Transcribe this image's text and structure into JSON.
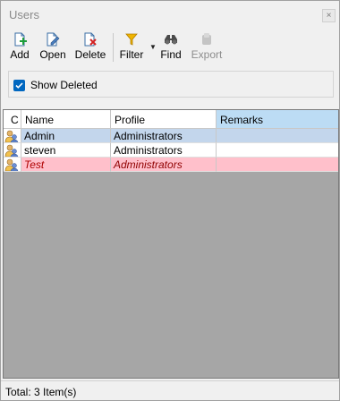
{
  "window": {
    "title": "Users",
    "close_glyph": "×"
  },
  "toolbar": {
    "add": {
      "label": "Add",
      "icon": "add-document-icon"
    },
    "open": {
      "label": "Open",
      "icon": "open-document-icon"
    },
    "delete": {
      "label": "Delete",
      "icon": "delete-document-icon"
    },
    "filter": {
      "label": "Filter",
      "icon": "funnel-icon"
    },
    "find": {
      "label": "Find",
      "icon": "binoculars-icon"
    },
    "export": {
      "label": "Export",
      "icon": "export-icon",
      "disabled": true
    }
  },
  "options": {
    "show_deleted_label": "Show Deleted",
    "show_deleted_checked": true
  },
  "grid": {
    "columns": [
      "C",
      "Name",
      "Profile",
      "Remarks"
    ],
    "sorted_column": "Remarks",
    "rows": [
      {
        "name": "Admin",
        "profile": "Administrators",
        "remarks": "",
        "state": "selected"
      },
      {
        "name": "steven",
        "profile": "Administrators",
        "remarks": "",
        "state": "normal"
      },
      {
        "name": "Test",
        "profile": "Administrators",
        "remarks": "",
        "state": "deleted"
      }
    ]
  },
  "status": {
    "text": "Total: 3 Item(s)"
  },
  "colors": {
    "accent": "#0067c0",
    "selected_row": "#c3d6ec",
    "deleted_row": "#ffc0cb",
    "sorted_header": "#bcdcf4",
    "grid_empty_area": "#a6a6a6"
  }
}
